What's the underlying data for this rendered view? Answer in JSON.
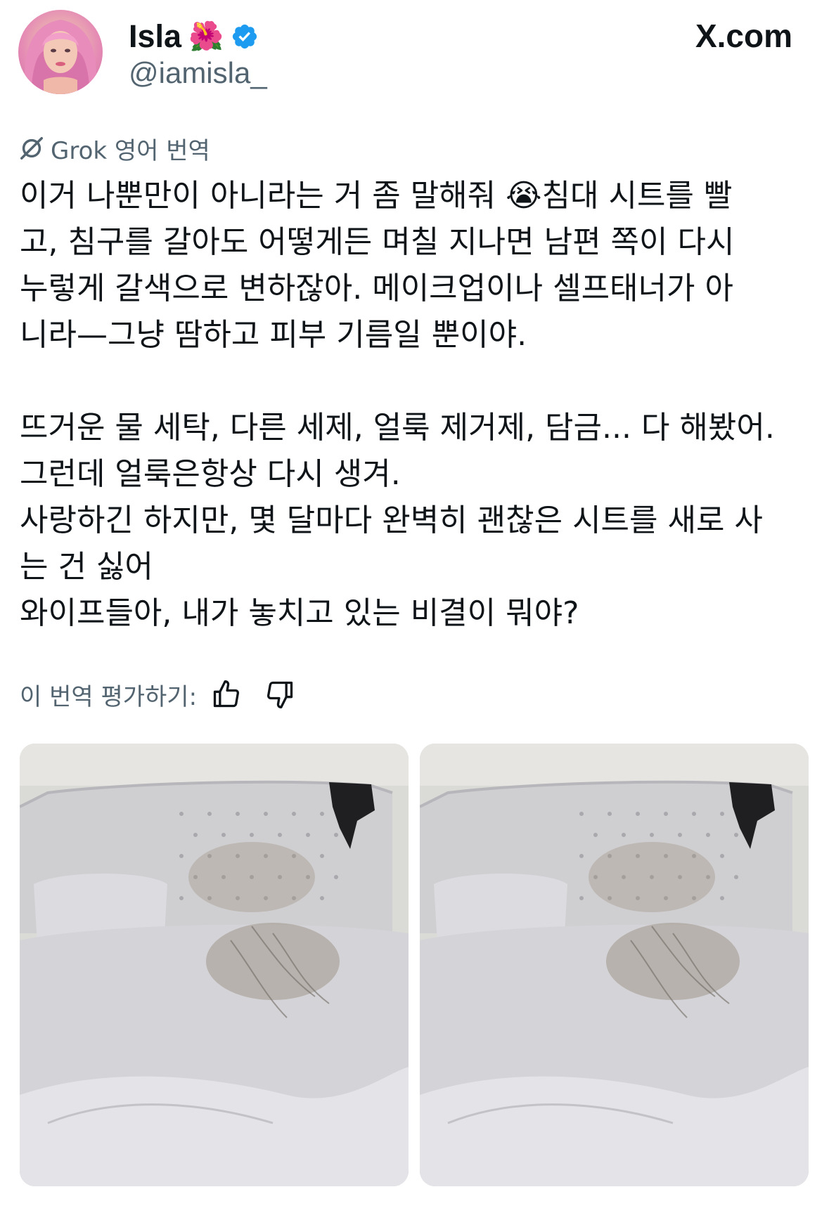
{
  "post": {
    "author": {
      "display_name": "Isla",
      "name_emoji": "🌺",
      "verified_icon": "verified-badge-icon",
      "handle": "@iamisla_"
    },
    "site": "X.com",
    "translation_label": "Grok 영어 번역",
    "text_lines": [
      "이거 나뿐만이 아니라는 거 좀 말해줘 😭침대 시트를 빨",
      "고, 침구를 갈아도 어떻게든 며칠 지나면 남편 쪽이 다시",
      "누렇게 갈색으로 변하잖아. 메이크업이나 셀프태너가 아",
      "니라—그냥 땀하고 피부 기름일 뿐이야.",
      "",
      "뜨거운 물 세탁, 다른 세제, 얼룩 제거제, 담금... 다 해봤어.",
      "그런데 얼룩은항상 다시 생겨.",
      "사랑하긴 하지만, 몇 달마다 완벽히 괜찮은 시트를 새로 사",
      "는 건 싫어",
      "와이프들아, 내가 놓치고 있는 비결이 뭐야?"
    ],
    "rate_label": "이 번역 평가하기:",
    "rate_icons": [
      "thumbs-up-icon",
      "thumbs-down-icon"
    ],
    "media_count": 2,
    "colors": {
      "text": "#0f1419",
      "secondary": "#536471",
      "verified": "#1d9bf0"
    }
  }
}
